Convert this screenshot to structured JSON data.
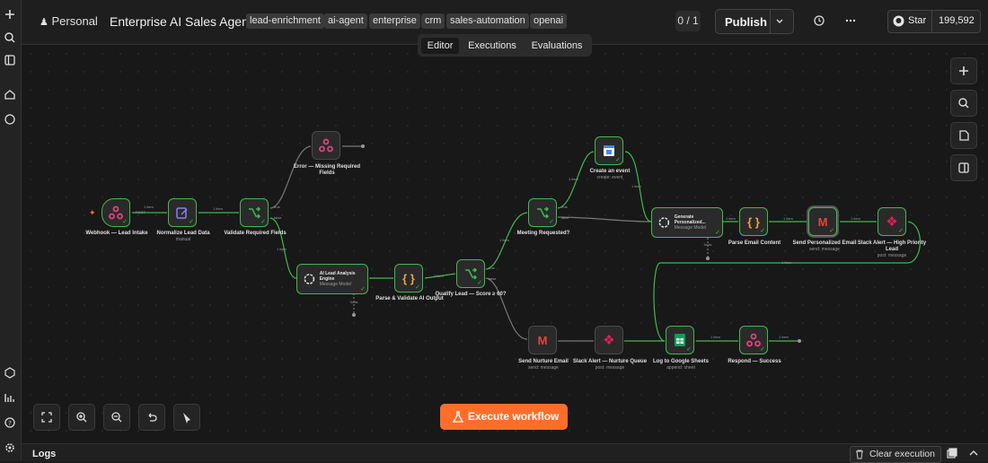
{
  "sidebar": {
    "icons": [
      "plus-icon",
      "search-icon",
      "panel-icon",
      "home-icon",
      "chat-icon",
      "cube-icon",
      "chart-icon",
      "help-icon",
      "settings-icon"
    ]
  },
  "header": {
    "project": "Personal",
    "title": "Enterprise AI Sales Agent",
    "tags": [
      "lead-enrichment",
      "ai-agent",
      "enterprise",
      "crm",
      "sales-automation",
      "openai"
    ],
    "counter": "0 / 1",
    "publish_label": "Publish",
    "star_label": "Star",
    "star_count": "199,592"
  },
  "tabs": [
    "Editor",
    "Executions",
    "Evaluations"
  ],
  "active_tab": "Editor",
  "nodes": {
    "webhook": {
      "label": "Webhook — Lead Intake"
    },
    "normalize": {
      "label": "Normalize Lead Data",
      "sub": "manual"
    },
    "validate": {
      "label": "Validate Required Fields"
    },
    "error": {
      "label": "Error — Missing Required Fields"
    },
    "ai_engine": {
      "title": "AI Lead Analysis Engine",
      "sub": "Message Model"
    },
    "parse_ai": {
      "label": "Parse & Validate AI Output"
    },
    "qualify": {
      "label": "Qualify Lead — Score ≥ 60?"
    },
    "meeting": {
      "label": "Meeting Requested?"
    },
    "create_event": {
      "label": "Create an event",
      "sub": "create: event"
    },
    "gen_email": {
      "title": "Generate Personalized...",
      "sub": "Message Model"
    },
    "parse_email": {
      "label": "Parse Email Content"
    },
    "send_email": {
      "label": "Send Personalized Email",
      "sub": "send: message"
    },
    "slack_high": {
      "label": "Slack Alert — High Priority Lead",
      "sub": "post: message"
    },
    "nurture": {
      "label": "Send Nurture Email",
      "sub": "send: message"
    },
    "slack_nurture": {
      "label": "Slack Alert — Nurture Queue",
      "sub": "post: message"
    },
    "sheets": {
      "label": "Log to Google Sheets",
      "sub": "append: sheet"
    },
    "respond": {
      "label": "Respond — Success"
    }
  },
  "wire_labels": {
    "post": "POST",
    "item": "1 item",
    "true": "true",
    "false": "false",
    "tools": "Tools"
  },
  "canvas_tools": [
    "zoom-fit-icon",
    "zoom-in-icon",
    "zoom-out-icon",
    "undo-icon",
    "tidy-icon"
  ],
  "execute_label": "Execute workflow",
  "footer": {
    "logs_label": "Logs",
    "clear_label": "Clear execution"
  },
  "colors": {
    "accent": "#ff6d2b",
    "success": "#3fb950",
    "ai_sub": "#9a9a9a"
  }
}
